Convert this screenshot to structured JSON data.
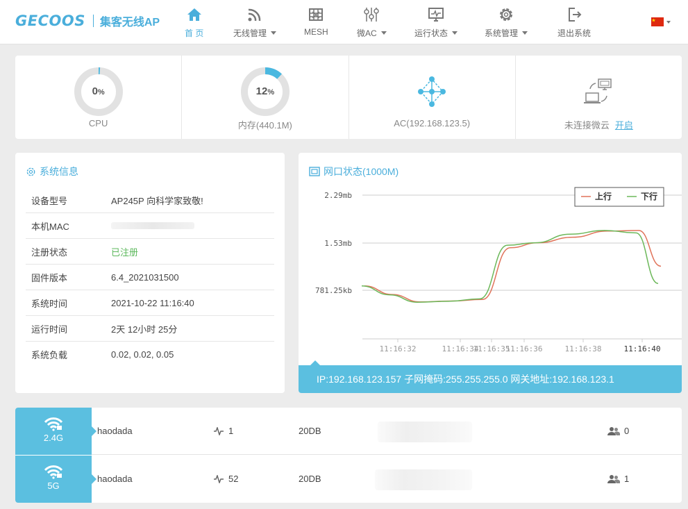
{
  "brand": {
    "logo": "GECOOS",
    "subtitle": "集客无线AP"
  },
  "nav": [
    {
      "label": "首 页",
      "icon": "home-icon",
      "active": true,
      "dropdown": false
    },
    {
      "label": "无线管理",
      "icon": "wifi-signal-icon",
      "dropdown": true
    },
    {
      "label": "MESH",
      "icon": "mesh-grid-icon",
      "dropdown": false
    },
    {
      "label": "微AC",
      "icon": "sliders-icon",
      "dropdown": true
    },
    {
      "label": "运行状态",
      "icon": "monitor-pulse-icon",
      "dropdown": true
    },
    {
      "label": "系统管理",
      "icon": "gear-icon",
      "dropdown": true
    },
    {
      "label": "退出系统",
      "icon": "logout-icon",
      "dropdown": false
    }
  ],
  "language": {
    "flag": "china-flag-icon"
  },
  "stats": {
    "cpu": {
      "value": "0",
      "unit": "%",
      "label": "CPU",
      "percent": 0.01
    },
    "memory": {
      "value": "12",
      "unit": "%",
      "label": "内存(440.1M)",
      "percent": 0.12
    },
    "ac": {
      "label": "AC(192.168.123.5)"
    },
    "cloud": {
      "label": "未连接微云",
      "link": "开启"
    }
  },
  "sysinfo": {
    "title": "系统信息",
    "rows": [
      {
        "key": "设备型号",
        "value": "AP245P 向科学家致敬!"
      },
      {
        "key": "本机MAC",
        "value": ""
      },
      {
        "key": "注册状态",
        "value": "已注册"
      },
      {
        "key": "固件版本",
        "value": "6.4_2021031500"
      },
      {
        "key": "系统时间",
        "value": "2021-10-22 11:16:40"
      },
      {
        "key": "运行时间",
        "value": "2天 12小时 25分"
      },
      {
        "key": "系统负载",
        "value": "0.02, 0.02, 0.05"
      }
    ]
  },
  "network": {
    "title": "网口状态(1000M)",
    "footer": "IP:192.168.123.157  子网掩码:255.255.255.0  网关地址:192.168.123.1"
  },
  "chart_data": {
    "type": "line",
    "y_ticks": [
      "2.29mb",
      "1.53mb",
      "781.25kb"
    ],
    "x_ticks": [
      "11:16:32",
      "11:16:34",
      "11:16:35",
      "11:16:36",
      "11:16:38",
      "11:16:40"
    ],
    "legend": [
      "上行",
      "下行"
    ],
    "legend_position": "top-right",
    "grid": true,
    "colors": {
      "up": "#e0735a",
      "down": "#6cb85a"
    },
    "series": [
      {
        "name": "上行",
        "values_kb": [
          860,
          720,
          600,
          615,
          640,
          1480,
          1560,
          1650,
          1750,
          1760,
          1180
        ]
      },
      {
        "name": "下行",
        "values_kb": [
          860,
          715,
          595,
          610,
          650,
          1520,
          1560,
          1700,
          1760,
          1720,
          900
        ]
      }
    ]
  },
  "wifi": [
    {
      "band": "2.4G",
      "ssid": "haodada",
      "rate": "1",
      "power": "20DB",
      "clients": "0"
    },
    {
      "band": "5G",
      "ssid": "haodada",
      "rate": "52",
      "power": "20DB",
      "clients": "1"
    }
  ]
}
